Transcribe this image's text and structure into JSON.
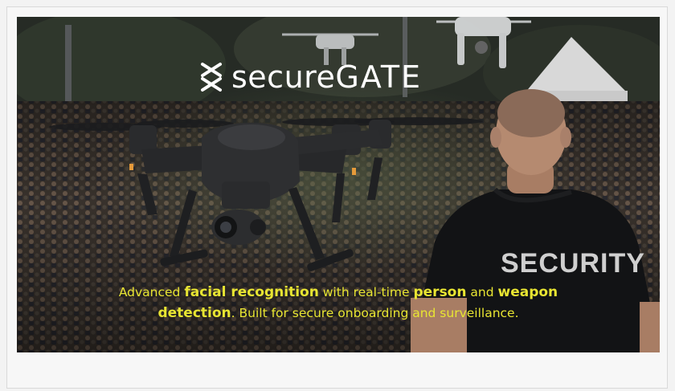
{
  "hero": {
    "brand_part1": "secure",
    "brand_part2": "GATE",
    "security_shirt_text": "SECURITY",
    "tagline": {
      "t1": "Advanced ",
      "b1": "facial recognition",
      "t2": " with real-time ",
      "b2": "person",
      "t3": " and ",
      "b3": "weapon",
      "b4": "detection",
      "t4": ". Built for secure onboarding and surveillance."
    }
  },
  "colors": {
    "tagline": "#e8e532",
    "brand": "#ffffff",
    "frame_bg": "#f7f7f7"
  }
}
